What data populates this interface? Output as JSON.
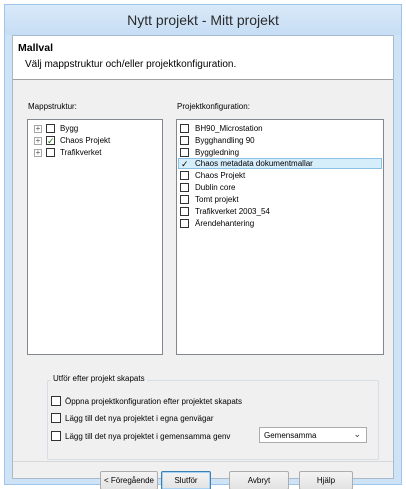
{
  "window": {
    "title": "Nytt projekt - Mitt projekt"
  },
  "header": {
    "title": "Mallval",
    "subtitle": "Välj mappstruktur och/eller projektkonfiguration."
  },
  "folder_structure": {
    "label": "Mappstruktur:",
    "items": [
      {
        "label": "Bygg",
        "checked": false
      },
      {
        "label": "Chaos Projekt",
        "checked": true
      },
      {
        "label": "Trafikverket",
        "checked": false
      }
    ]
  },
  "project_config": {
    "label": "Projektkonfiguration:",
    "items": [
      {
        "label": "BH90_Microstation",
        "checked": false
      },
      {
        "label": "Bygghandling 90",
        "checked": false
      },
      {
        "label": "Byggledning",
        "checked": false
      },
      {
        "label": "Chaos metadata dokumentmallar",
        "checked": true,
        "selected": true
      },
      {
        "label": "Chaos Projekt",
        "checked": false
      },
      {
        "label": "Dublin core",
        "checked": false
      },
      {
        "label": "Tomt projekt",
        "checked": false
      },
      {
        "label": "Trafikverket 2003_54",
        "checked": false
      },
      {
        "label": "Ärendehantering",
        "checked": false
      }
    ]
  },
  "after_create": {
    "title": "Utför efter projekt skapats",
    "options": [
      {
        "label": "Öppna projektkonfiguration efter projektet skapats",
        "checked": false
      },
      {
        "label": "Lägg till det nya projektet i egna genvägar",
        "checked": false
      },
      {
        "label": "Lägg till det nya projektet i gemensamma genv",
        "checked": false
      }
    ],
    "shortcut_group": {
      "selected": "Gemensamma"
    }
  },
  "buttons": {
    "back": "< Föregående",
    "finish": "Slutför",
    "cancel": "Avbryt",
    "help": "Hjälp"
  }
}
